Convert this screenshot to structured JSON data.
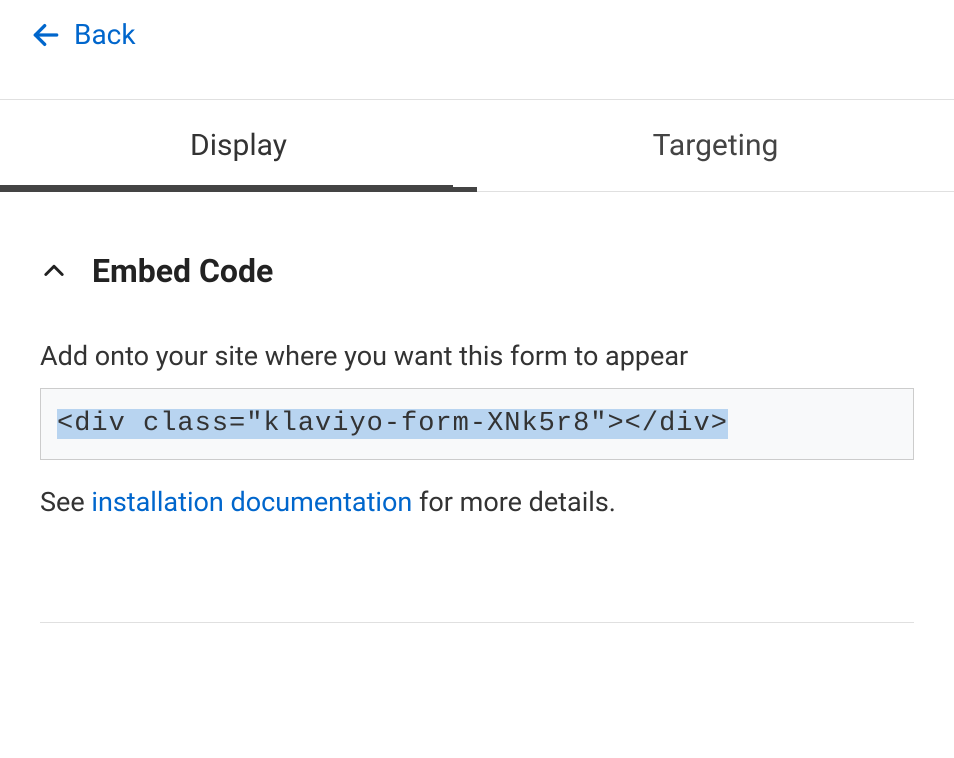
{
  "back": {
    "label": "Back"
  },
  "tabs": [
    {
      "label": "Display",
      "active": true
    },
    {
      "label": "Targeting",
      "active": false
    }
  ],
  "section": {
    "title": "Embed Code",
    "instruction": "Add onto your site where you want this form to appear",
    "code": "<div class=\"klaviyo-form-XNk5r8\"></div>",
    "footer_prefix": "See ",
    "footer_link": "installation documentation",
    "footer_suffix": " for more details."
  }
}
